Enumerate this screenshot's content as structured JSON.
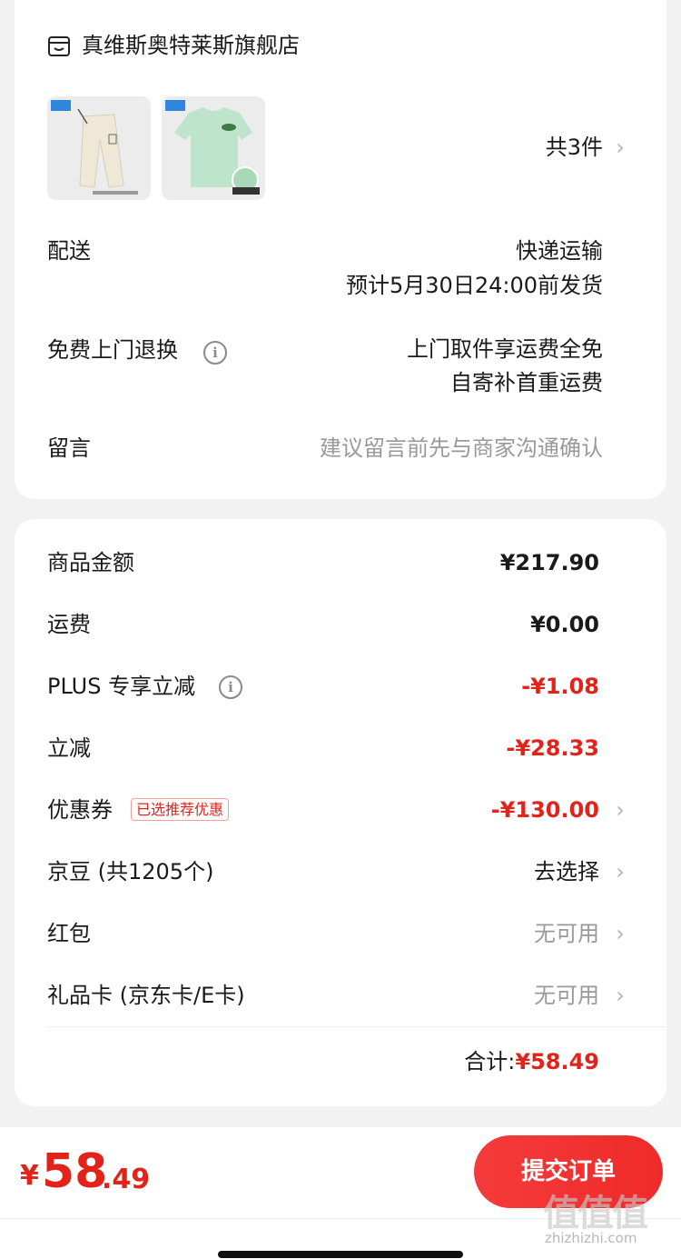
{
  "shop": {
    "icon": "shop-icon",
    "name": "真维斯奥特莱斯旗舰店",
    "item_count": "共3件",
    "products": [
      {
        "name": "pants-thumbnail",
        "color": "#efe8d6"
      },
      {
        "name": "tshirt-thumbnail",
        "color": "#bfe4cc"
      }
    ],
    "rows": [
      {
        "label": "配送",
        "value_line1": "快递运输",
        "value_line2": "预计5月30日24:00前发货"
      },
      {
        "label": "免费上门退换",
        "value_line1": "上门取件享运费全免",
        "value_line2": "自寄补首重运费"
      },
      {
        "label": "留言",
        "placeholder": "建议留言前先与商家沟通确认"
      }
    ]
  },
  "price": {
    "goods_amount": {
      "label": "商品金额",
      "value": "¥217.90"
    },
    "shipping": {
      "label": "运费",
      "value": "¥0.00"
    },
    "plus_discount": {
      "label": "PLUS 专享立减",
      "value": "-¥1.08"
    },
    "instant_discount": {
      "label": "立减",
      "value": "-¥28.33"
    },
    "coupon": {
      "label": "优惠券",
      "tag": "已选推荐优惠",
      "value": "-¥130.00"
    },
    "jingdou": {
      "label": "京豆 (共1205个)",
      "value": "去选择"
    },
    "red_packet": {
      "label": "红包",
      "value": "无可用"
    },
    "gift_card": {
      "label": "礼品卡 (京东卡/E卡)",
      "value": "无可用"
    },
    "total": {
      "label": "合计:",
      "value": "¥58.49"
    }
  },
  "bottom": {
    "currency": "¥",
    "amount_int": "58",
    "amount_dec": ".49",
    "submit_label": "提交订单",
    "watermark": "值值值",
    "watermark_url": "zhizhizhi.com"
  },
  "colors": {
    "accent_red": "#e2231a",
    "background": "#f2f2f2",
    "card": "#ffffff"
  }
}
